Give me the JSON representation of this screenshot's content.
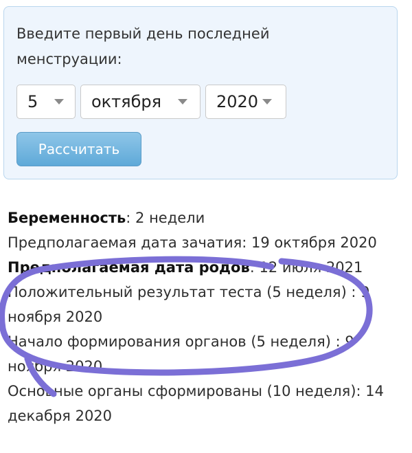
{
  "form": {
    "prompt": "Введите первый день последней менструации:",
    "day": "5",
    "month": "октября",
    "year": "2020",
    "button": "Рассчитать"
  },
  "results": {
    "pregnancy_label": "Беременность",
    "pregnancy_value": ": 2 недели",
    "conception": "Предполагаемая дата зачатия: 19 октября 2020",
    "due_label": "Предполагаемая дата родов",
    "due_value": ": 12 июля 2021",
    "test": "Положительный результат теста (5 неделя) : 9 ноября 2020",
    "organs_start": "Начало формирования органов (5 неделя) : 9 ноября 2020",
    "organs_done": "Основные органы сформированы (10 неделя): 14 декабря 2020"
  },
  "colors": {
    "scribble": "#7b6fd6",
    "panel_bg": "#eef5fd",
    "panel_border": "#b9d6ee",
    "button_bg": "#6cb3df"
  },
  "icons": {
    "select_caret": "chevron-down-icon"
  }
}
